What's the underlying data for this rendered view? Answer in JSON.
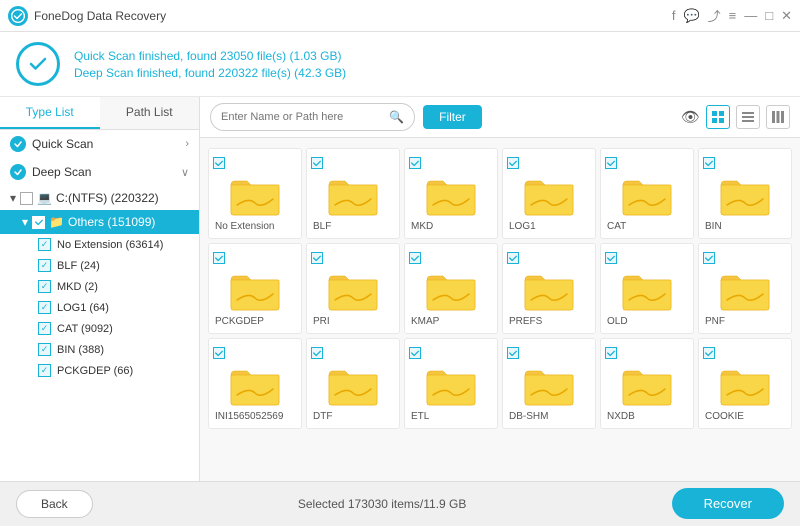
{
  "titleBar": {
    "title": "FoneDog Data Recovery",
    "icons": [
      "facebook",
      "chat",
      "share",
      "menu",
      "minimize",
      "maximize",
      "close"
    ]
  },
  "header": {
    "quickScan": "Quick Scan finished, found ",
    "quickScanFiles": "23050 file(s)",
    "quickScanSize": " (1.03 GB)",
    "deepScan": "Deep Scan finished, found ",
    "deepScanFiles": "220322 file(s)",
    "deepScanSize": " (42.3 GB)"
  },
  "sidebar": {
    "tabs": [
      "Type List",
      "Path List"
    ],
    "activeTab": "Type List",
    "scanTypes": [
      {
        "label": "Quick Scan",
        "chevron": "›"
      },
      {
        "label": "Deep Scan",
        "chevron": "∨"
      }
    ],
    "drive": "C:(NTFS) (220322)",
    "folder": "Others (151099)",
    "subItems": [
      "No Extension (63614)",
      "BLF (24)",
      "MKD (2)",
      "LOG1 (64)",
      "CAT (9092)",
      "BIN (388)",
      "PCKGDEP (66)"
    ]
  },
  "toolbar": {
    "searchPlaceholder": "Enter Name or Path here",
    "filterLabel": "Filter",
    "views": [
      "eye",
      "grid",
      "list",
      "columns"
    ]
  },
  "fileGrid": [
    {
      "label": "No Extension"
    },
    {
      "label": "BLF"
    },
    {
      "label": "MKD"
    },
    {
      "label": "LOG1"
    },
    {
      "label": "CAT"
    },
    {
      "label": "BIN"
    },
    {
      "label": "PCKGDEP"
    },
    {
      "label": "PRI"
    },
    {
      "label": "KMAP"
    },
    {
      "label": "PREFS"
    },
    {
      "label": "OLD"
    },
    {
      "label": "PNF"
    },
    {
      "label": "INI1565052569"
    },
    {
      "label": "DTF"
    },
    {
      "label": "ETL"
    },
    {
      "label": "DB-SHM"
    },
    {
      "label": "NXDB"
    },
    {
      "label": "COOKIE"
    }
  ],
  "bottomBar": {
    "backLabel": "Back",
    "selectedInfo": "Selected 173030 items/11.9 GB",
    "recoverLabel": "Recover"
  }
}
